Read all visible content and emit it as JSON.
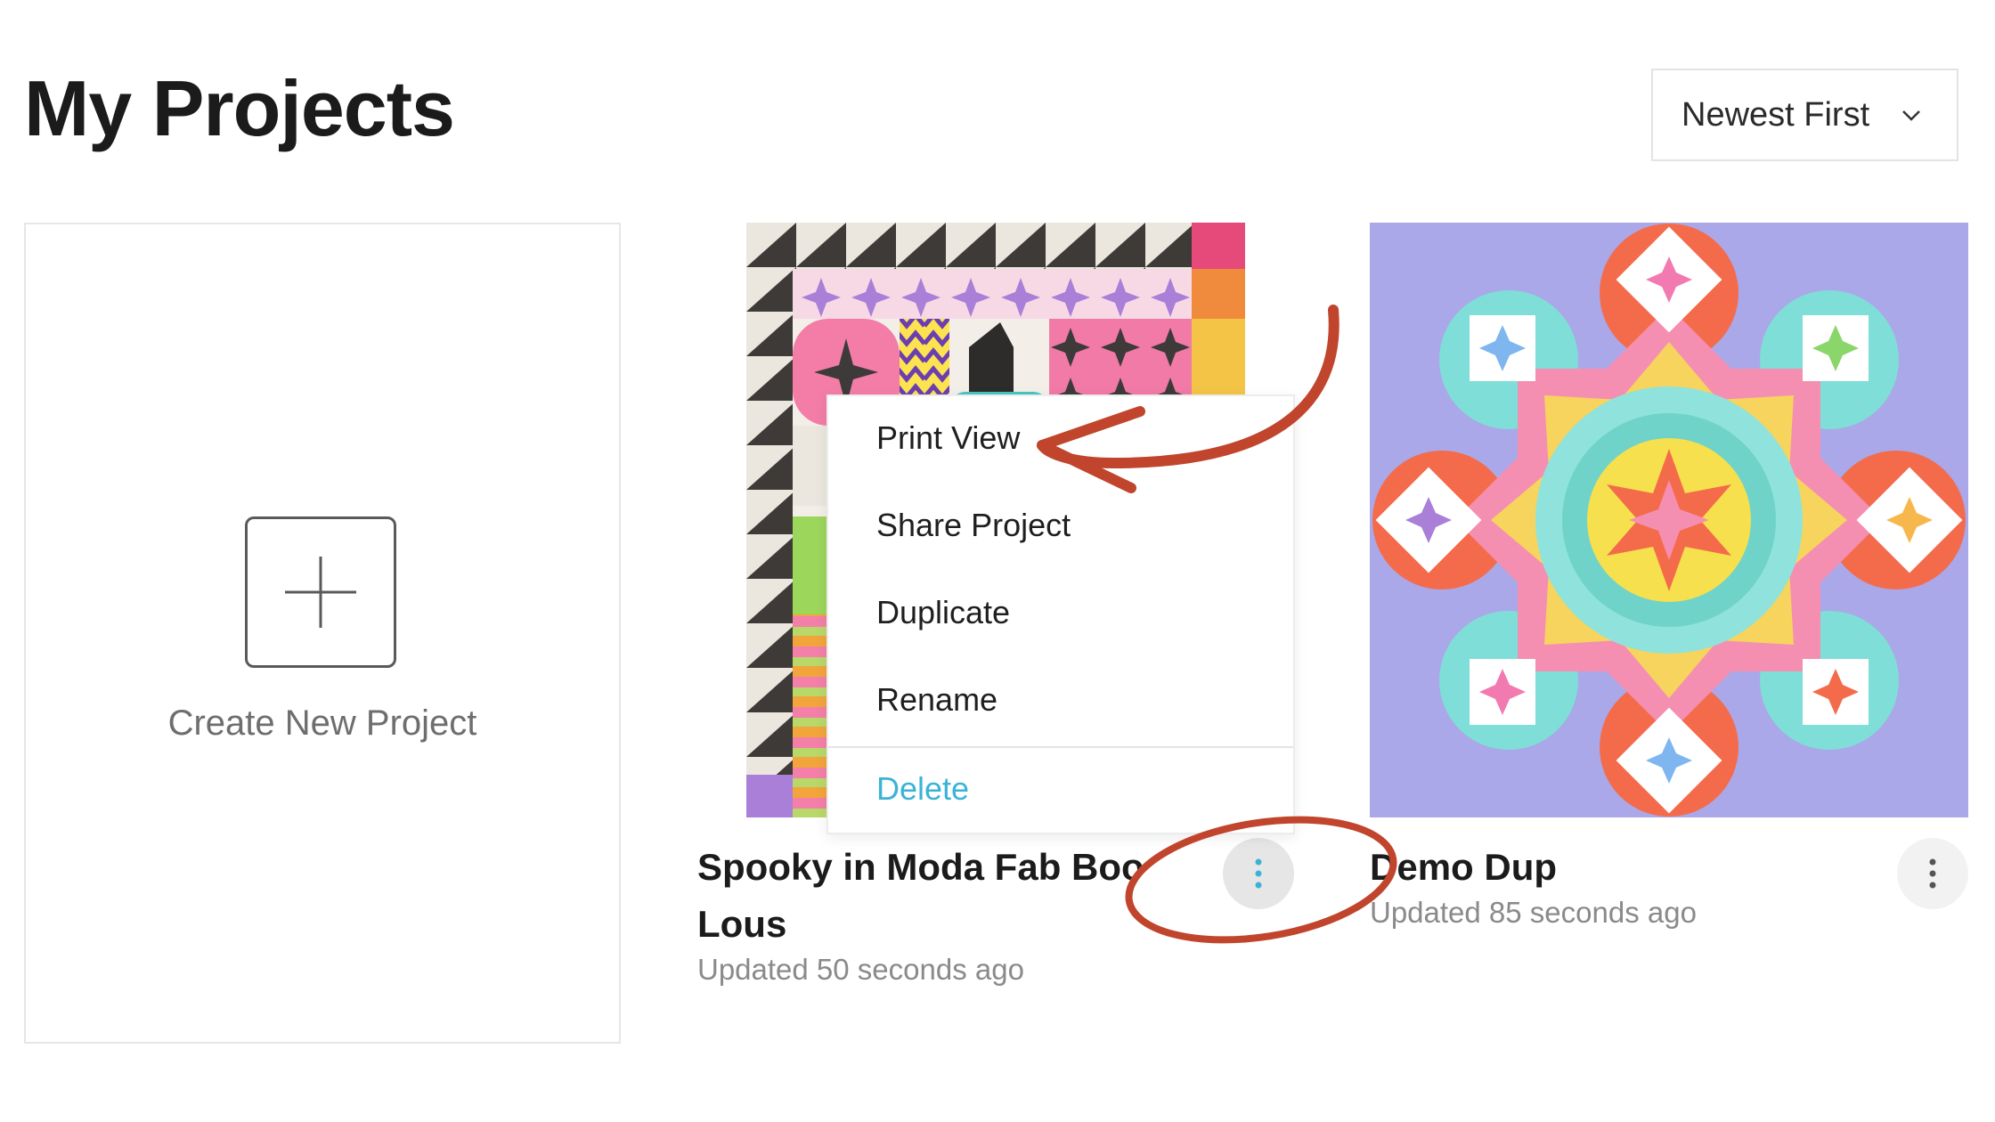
{
  "header": {
    "title": "My Projects",
    "sort": {
      "selected": "Newest First",
      "icon": "chevron-down-icon"
    }
  },
  "create_card": {
    "label": "Create New Project",
    "icon": "plus-icon"
  },
  "projects": [
    {
      "title_line1": "Spooky in Moda Fab Boo",
      "title_line2": "Lous",
      "updated": "Updated 50 seconds ago",
      "menu_icon": "more-vertical-icon"
    },
    {
      "title_line1": "Demo Dup",
      "updated": "Updated 85 seconds ago",
      "menu_icon": "more-vertical-icon"
    }
  ],
  "context_menu": {
    "items": [
      "Print View",
      "Share Project",
      "Duplicate",
      "Rename"
    ],
    "delete_label": "Delete",
    "delete_color": "#3bb3d6"
  },
  "annotation": {
    "color": "#c0452c"
  },
  "colors": {
    "thumb2_bg": "#aaa8e8",
    "quilt_pink": "#f58fb2",
    "quilt_orange": "#f46b4c",
    "quilt_teal": "#7fded7",
    "quilt_yellow": "#f6e04d"
  }
}
